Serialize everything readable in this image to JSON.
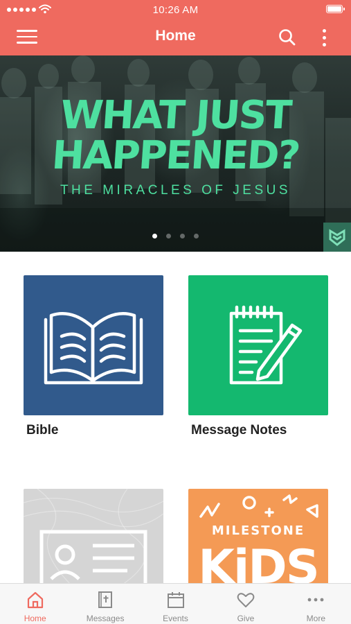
{
  "status_bar": {
    "time": "10:26 AM"
  },
  "header": {
    "title": "Home",
    "menu_icon": "hamburger-menu-icon",
    "search_icon": "search-icon",
    "more_icon": "vertical-ellipsis-icon",
    "background_color": "#ef6a5f"
  },
  "banner": {
    "headline_line1": "WHAT JUST",
    "headline_line2": "HAPPENED?",
    "subtitle": "THE MIRACLES OF JESUS",
    "accent_color": "#4ee0a0",
    "carousel_page_count": 4,
    "carousel_active_index": 0
  },
  "tiles": [
    {
      "label": "Bible",
      "icon": "open-book-icon",
      "color": "#315a8c"
    },
    {
      "label": "Message Notes",
      "icon": "notepad-pencil-icon",
      "color": "#14b86f"
    },
    {
      "label": "",
      "icon": "contact-card-icon",
      "color": "#d5d5d5"
    },
    {
      "label": "",
      "icon": "milestone-kids-logo",
      "color": "#f49a55",
      "logo_text_top": "MILESTONE",
      "logo_text_main": "KiDS"
    }
  ],
  "tabbar": {
    "active_color": "#ef6a5f",
    "items": [
      {
        "label": "Home",
        "icon": "home-icon",
        "active": true
      },
      {
        "label": "Messages",
        "icon": "bible-cross-icon",
        "active": false
      },
      {
        "label": "Events",
        "icon": "calendar-icon",
        "active": false
      },
      {
        "label": "Give",
        "icon": "heart-icon",
        "active": false
      },
      {
        "label": "More",
        "icon": "more-dots-icon",
        "active": false
      }
    ]
  }
}
